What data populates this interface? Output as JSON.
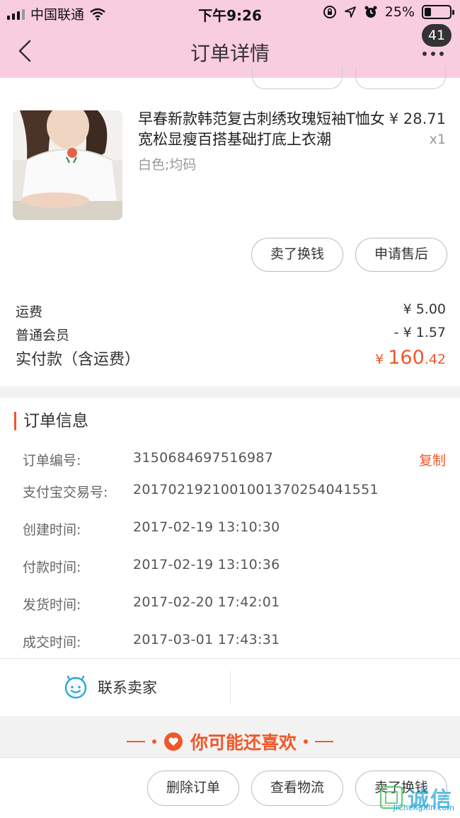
{
  "status_bar": {
    "carrier": "中国联通",
    "time": "下午9:26",
    "battery": "25%",
    "battery_level": 0.25
  },
  "nav": {
    "title": "订单详情",
    "badge": "41"
  },
  "item": {
    "title": "早春新款韩范复古刺绣玫瑰短袖T恤女宽松显瘦百搭基础打底上衣潮",
    "sku": "白色;均码",
    "price": "¥ 28.71",
    "qty": "x1",
    "buttons": {
      "sell": "卖了换钱",
      "after_sale": "申请售后"
    }
  },
  "fees": {
    "shipping_label": "运费",
    "shipping_value": "¥ 5.00",
    "member_label": "普通会员",
    "member_value": "- ¥ 1.57",
    "total_label": "实付款（含运费）",
    "total_currency": "¥ ",
    "total_int": "160",
    "total_dec": ".42"
  },
  "order_info": {
    "title": "订单信息",
    "copy_label": "复制",
    "rows": [
      {
        "label": "订单编号:",
        "value": "3150684697516987"
      },
      {
        "label": "支付宝交易号:",
        "value": "2017021921001001370254041551"
      },
      {
        "label": "创建时间:",
        "value": "2017-02-19 13:10:30"
      },
      {
        "label": "付款时间:",
        "value": "2017-02-19 13:10:36"
      },
      {
        "label": "发货时间:",
        "value": "2017-02-20 17:42:01"
      },
      {
        "label": "成交时间:",
        "value": "2017-03-01 17:43:31"
      }
    ],
    "contact_label": "联系卖家"
  },
  "recommend": {
    "title": "你可能还喜欢"
  },
  "bottom_bar": {
    "delete": "删除订单",
    "logistics": "查看物流",
    "sell": "卖了换钱"
  },
  "watermark": {
    "text": "诚信",
    "sub": "JiChengXin.com"
  },
  "colors": {
    "nav_bg": "#f9cde0",
    "accent": "#f0572a"
  }
}
